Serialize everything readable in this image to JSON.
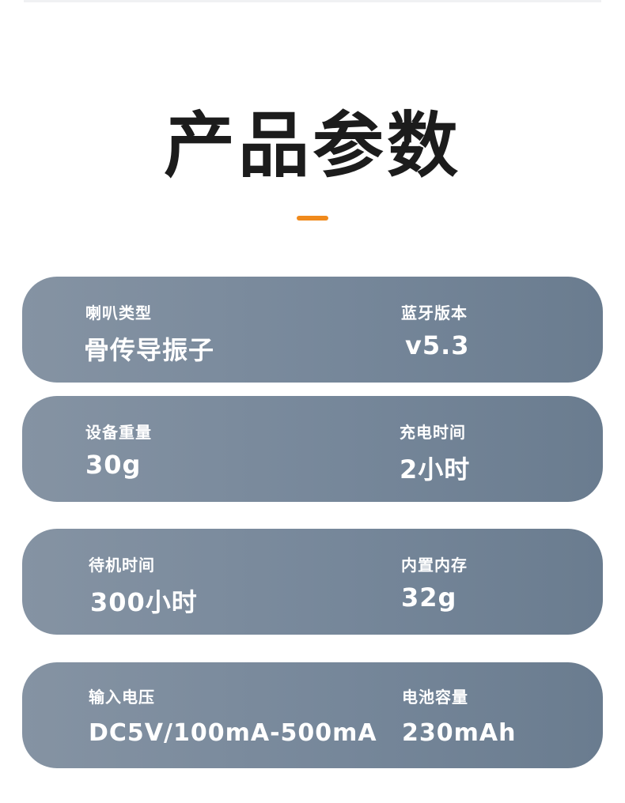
{
  "title": "产品参数",
  "accent_color": "#f08a1c",
  "card_color": "#7a8a9c",
  "specs": [
    {
      "left_label": "喇叭类型",
      "left_value": "骨传导振子",
      "right_label": "蓝牙版本",
      "right_value": "v5.3"
    },
    {
      "left_label": "设备重量",
      "left_value": "30g",
      "right_label": "充电时间",
      "right_value": "2小时"
    },
    {
      "left_label": "待机时间",
      "left_value": "300小时",
      "right_label": "内置内存",
      "right_value": "32g"
    },
    {
      "left_label": "输入电压",
      "left_value": "DC5V/100mA-500mA",
      "right_label": "电池容量",
      "right_value": "230mAh"
    }
  ]
}
